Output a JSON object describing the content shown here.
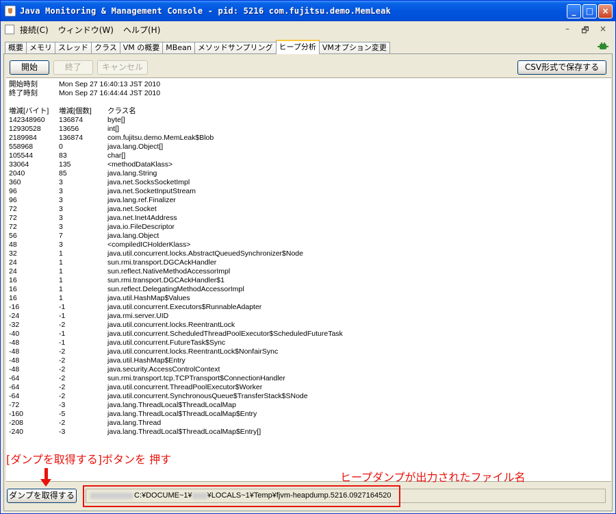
{
  "window": {
    "title": "Java Monitoring & Management Console - pid: 5216 com.fujitsu.demo.MemLeak",
    "minimize": "_",
    "maximize": "□",
    "close": "×"
  },
  "menubar": {
    "items": [
      "接続(C)",
      "ウィンドウ(W)",
      "ヘルプ(H)"
    ],
    "mdi_min": "–",
    "mdi_restore": "🗗",
    "mdi_close": "×"
  },
  "tabs": [
    "概要",
    "メモリ",
    "スレッド",
    "クラス",
    "VM の概要",
    "MBean",
    "メソッドサンプリング",
    "ヒープ分析",
    "VMオプション変更"
  ],
  "active_tab_index": 7,
  "toolbar": {
    "start": "開始",
    "end": "終了",
    "cancel": "キャンセル",
    "save_csv": "CSV形式で保存する"
  },
  "result": {
    "start_label": "開始時刻",
    "start_time": "Mon Sep 27 16:40:13 JST 2010",
    "end_label": "終了時刻",
    "end_time": "Mon Sep 27 16:44:44 JST 2010",
    "headers": [
      "増減[バイト]",
      "増減[個数]",
      "クラス名"
    ],
    "rows": [
      [
        "142348960",
        "136874",
        "byte[]"
      ],
      [
        "12930528",
        "13656",
        "int[]"
      ],
      [
        "2189984",
        "136874",
        "com.fujitsu.demo.MemLeak$Blob"
      ],
      [
        "558968",
        "0",
        "java.lang.Object[]"
      ],
      [
        "105544",
        "83",
        "char[]"
      ],
      [
        "33064",
        "135",
        "<methodDataKlass>"
      ],
      [
        "2040",
        "85",
        "java.lang.String"
      ],
      [
        "360",
        "3",
        "java.net.SocksSocketImpl"
      ],
      [
        "96",
        "3",
        "java.net.SocketInputStream"
      ],
      [
        "96",
        "3",
        "java.lang.ref.Finalizer"
      ],
      [
        "72",
        "3",
        "java.net.Socket"
      ],
      [
        "72",
        "3",
        "java.net.Inet4Address"
      ],
      [
        "72",
        "3",
        "java.io.FileDescriptor"
      ],
      [
        "56",
        "7",
        "java.lang.Object"
      ],
      [
        "48",
        "3",
        "<compiledICHolderKlass>"
      ],
      [
        "32",
        "1",
        "java.util.concurrent.locks.AbstractQueuedSynchronizer$Node"
      ],
      [
        "24",
        "1",
        "sun.rmi.transport.DGCAckHandler"
      ],
      [
        "24",
        "1",
        "sun.reflect.NativeMethodAccessorImpl"
      ],
      [
        "16",
        "1",
        "sun.rmi.transport.DGCAckHandler$1"
      ],
      [
        "16",
        "1",
        "sun.reflect.DelegatingMethodAccessorImpl"
      ],
      [
        "16",
        "1",
        "java.util.HashMap$Values"
      ],
      [
        "-16",
        "-1",
        "java.util.concurrent.Executors$RunnableAdapter"
      ],
      [
        "-24",
        "-1",
        "java.rmi.server.UID"
      ],
      [
        "-32",
        "-2",
        "java.util.concurrent.locks.ReentrantLock"
      ],
      [
        "-40",
        "-1",
        "java.util.concurrent.ScheduledThreadPoolExecutor$ScheduledFutureTask"
      ],
      [
        "-48",
        "-1",
        "java.util.concurrent.FutureTask$Sync"
      ],
      [
        "-48",
        "-2",
        "java.util.concurrent.locks.ReentrantLock$NonfairSync"
      ],
      [
        "-48",
        "-2",
        "java.util.HashMap$Entry"
      ],
      [
        "-48",
        "-2",
        "java.security.AccessControlContext"
      ],
      [
        "-64",
        "-2",
        "sun.rmi.transport.tcp.TCPTransport$ConnectionHandler"
      ],
      [
        "-64",
        "-2",
        "java.util.concurrent.ThreadPoolExecutor$Worker"
      ],
      [
        "-64",
        "-2",
        "java.util.concurrent.SynchronousQueue$TransferStack$SNode"
      ],
      [
        "-72",
        "-3",
        "java.lang.ThreadLocal$ThreadLocalMap"
      ],
      [
        "-160",
        "-5",
        "java.lang.ThreadLocal$ThreadLocalMap$Entry"
      ],
      [
        "-208",
        "-2",
        "java.lang.Thread"
      ],
      [
        "-240",
        "-3",
        "java.lang.ThreadLocal$ThreadLocalMap$Entry[]"
      ]
    ]
  },
  "annotations": {
    "left": "[ダンプを取得する]ボタンを 押す",
    "right": "ヒープダンプが出力されたファイル名"
  },
  "bottom": {
    "dump_button": "ダンプを取得する",
    "dump_path": "C:¥DOCUME~1¥",
    "dump_path_rest": "¥LOCALS~1¥Temp¥fjvm-heapdump.5216.0927164520"
  },
  "colors": {
    "annotation_red": "#E8130C",
    "titlebar_blue": "#0254DE",
    "active_tab_accent": "#FFC83C"
  }
}
